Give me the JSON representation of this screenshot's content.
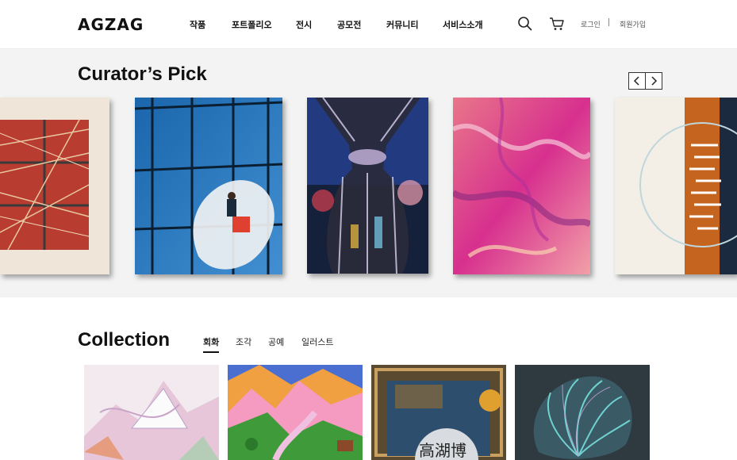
{
  "header": {
    "logo_text": "AGZAG",
    "nav": [
      "작품",
      "포트폴리오",
      "전시",
      "공모전",
      "커뮤니티",
      "서비스소개"
    ],
    "icons": [
      "search-icon",
      "cart-icon"
    ],
    "login": "로그인",
    "signup": "회원가입"
  },
  "curator": {
    "title": "Curator’s Pick",
    "prev_icon": "chevron-left-icon",
    "next_icon": "chevron-right-icon",
    "artworks": [
      {
        "subject": "abstract-red-grid",
        "colors": [
          "#b23a2e",
          "#d8c7b0"
        ]
      },
      {
        "subject": "window-cleaner-on-glass-building",
        "colors": [
          "#1f6fb5",
          "#f0f0f0"
        ]
      },
      {
        "subject": "glass-vase-night",
        "colors": [
          "#1a2a6b",
          "#c8b8d8"
        ]
      },
      {
        "subject": "pink-marble-abstract",
        "colors": [
          "#d6338a",
          "#e88a6a"
        ]
      },
      {
        "subject": "orange-circle-abstract",
        "colors": [
          "#c4641f",
          "#f4f1ea"
        ]
      }
    ]
  },
  "collection": {
    "title": "Collection",
    "tabs": [
      "회화",
      "조각",
      "공예",
      "일러스트"
    ],
    "active_tab": "회화",
    "items": [
      {
        "subject": "pastel-mountain",
        "colors": [
          "#f2e9ef",
          "#c9a3c8"
        ]
      },
      {
        "subject": "colorful-mountain-landscape",
        "colors": [
          "#3f9b3a",
          "#f29bc4"
        ]
      },
      {
        "subject": "clock-collage",
        "colors": [
          "#6a5a3a",
          "#2e4e6e"
        ]
      },
      {
        "subject": "teal-shell",
        "colors": [
          "#2a3a3e",
          "#6fd2d0"
        ]
      }
    ]
  }
}
